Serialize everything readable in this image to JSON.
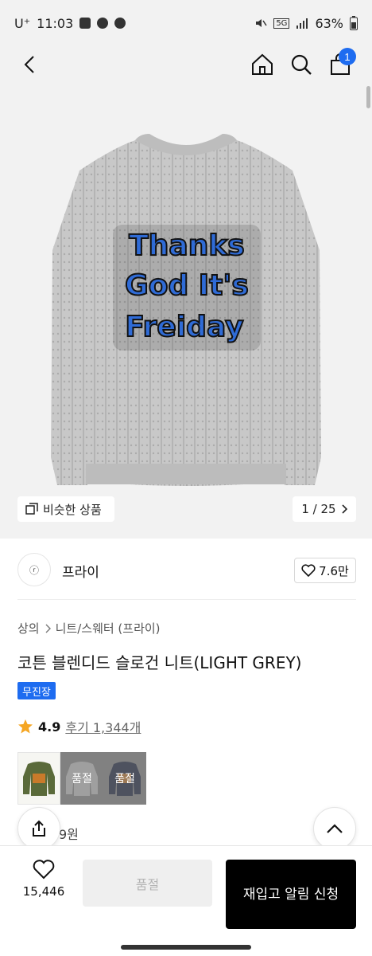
{
  "status_bar": {
    "carrier": "U⁺",
    "time": "11:03",
    "network": "5G",
    "battery": "63%"
  },
  "nav": {
    "cart_count": "1"
  },
  "gallery": {
    "similar_label": "비슷한 상품",
    "counter": "1 / 25",
    "print_lines": [
      "Thanks",
      "God It's",
      "Freiday"
    ]
  },
  "brand": {
    "logo_text": "ⓡ",
    "name": "프라이",
    "likes": "7.6만"
  },
  "product": {
    "breadcrumb": [
      "상의",
      "니트/스웨터 (프라이)"
    ],
    "title": "코튼 블렌디드 슬로건 니트(LIGHT GREY)",
    "badge": "무진장",
    "rating": "4.9",
    "reviews": "후기 1,344개",
    "price_partial": "9원"
  },
  "swatches": [
    {
      "color": "olive",
      "soldout": ""
    },
    {
      "color": "light-grey",
      "soldout": "품절"
    },
    {
      "color": "navy",
      "soldout": "품절"
    }
  ],
  "bottom_bar": {
    "wish_count": "15,446",
    "soldout_label": "품절",
    "restock_label": "재입고 알림 신청"
  },
  "colors": {
    "accent_blue": "#1e6cf0",
    "sweater": "#c9c9c9",
    "print_blue": "#2f6bd6"
  }
}
